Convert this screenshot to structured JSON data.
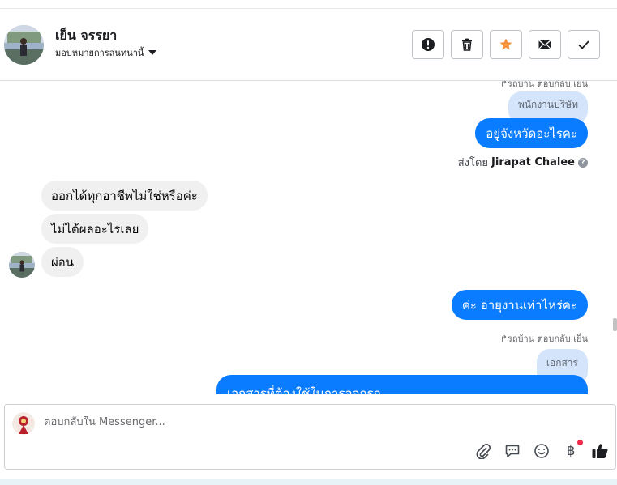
{
  "header": {
    "contact_name": "เย็น จรรยา",
    "assign_label": "มอบหมายการสนทนานี้",
    "actions": [
      "spam-icon",
      "trash-icon",
      "star-icon",
      "envelope-icon",
      "check-icon"
    ]
  },
  "messages": {
    "top_meta": "↱รถบ้าน ตอบกลับ เย็น",
    "reply_quote_1": "พนักงานบริษัท",
    "out_1": "อยู่จังหวัดอะไรคะ",
    "sent_by_prefix": "ส่งโดย",
    "sent_by_name": "Jirapat Chalee",
    "in_1": "ออกได้ทุกอาชีพไม่ใช่หรือค่ะ",
    "in_2": "ไม่ได้ผลอะไรเลย",
    "in_3": "ผ่อน",
    "out_2": "ค่ะ อายุงานเท่าไหร่คะ",
    "reply_meta": "↱รถบ้าน ตอบกลับ เย็น",
    "reply_quote_2": "เอกสาร",
    "out_3": "เอกสารที่ต้องใช้ในการออกรถ"
  },
  "composer": {
    "placeholder": "ตอบกลับใน Messenger..."
  },
  "colors": {
    "accent": "#0a7cff",
    "quote": "#d4e5fb",
    "incoming": "#f0f0f0",
    "star": "#f7923b"
  }
}
